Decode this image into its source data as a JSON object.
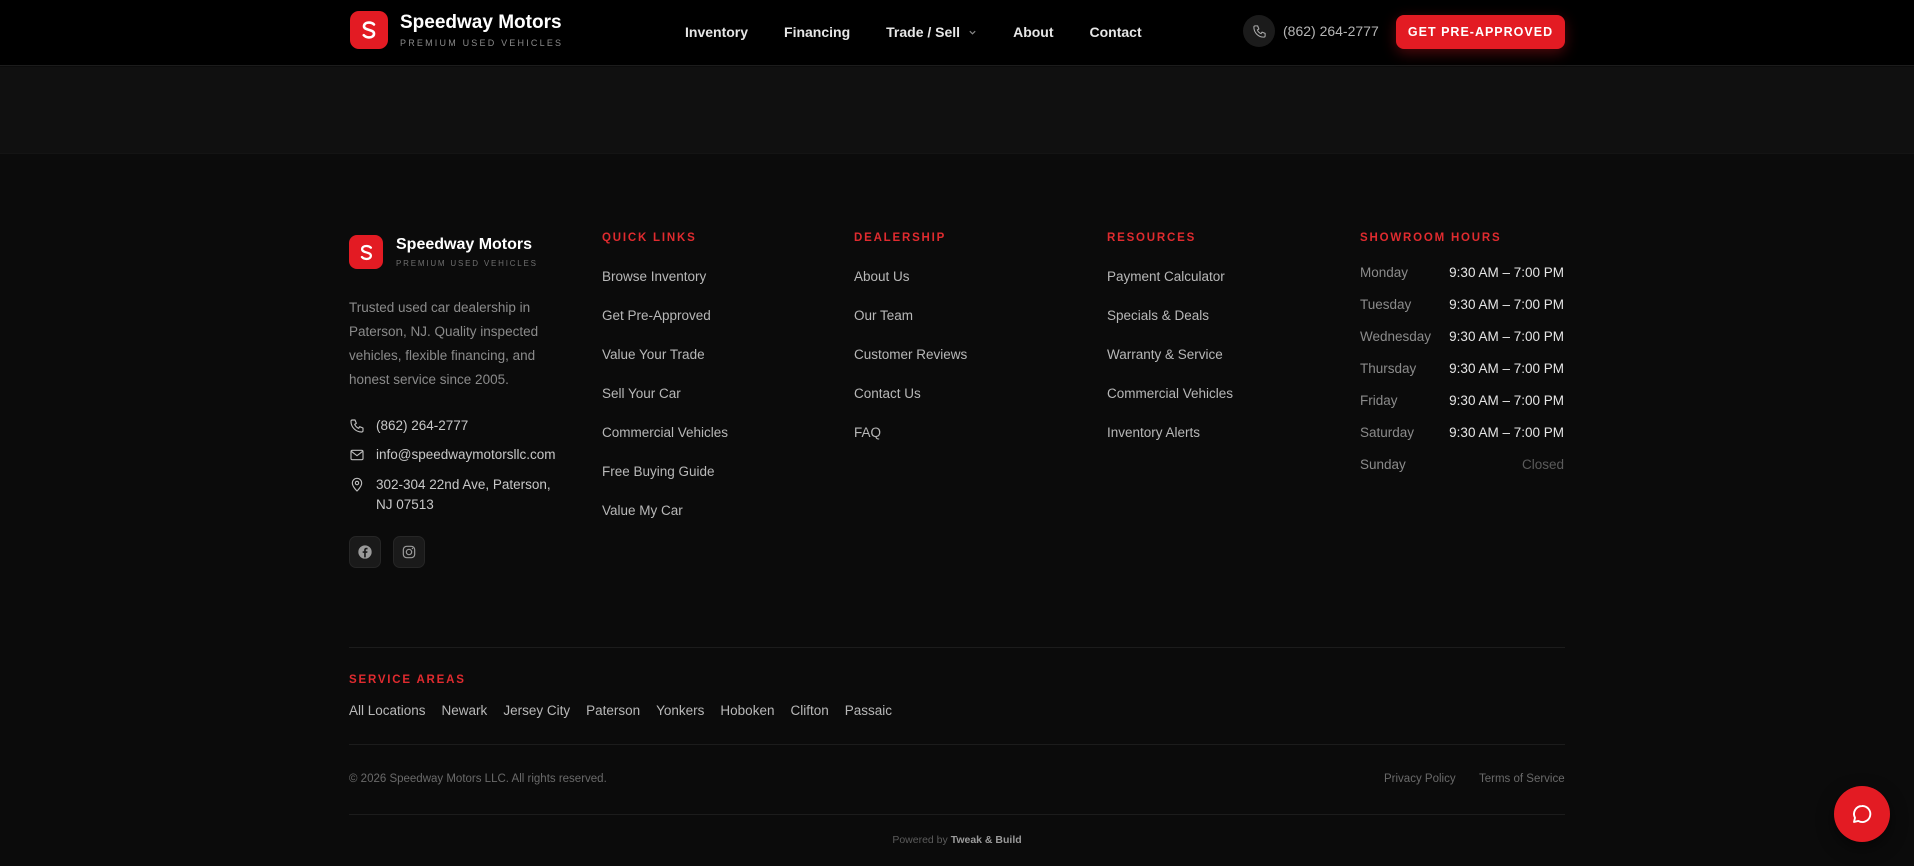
{
  "brand": {
    "name": "Speedway Motors",
    "tagline": "PREMIUM USED VEHICLES",
    "logo_icon": "s-logo-icon"
  },
  "nav": {
    "items": [
      "Inventory",
      "Financing",
      "Trade / Sell",
      "About",
      "Contact"
    ],
    "phone": "(862) 264-2777",
    "cta": "GET PRE-APPROVED"
  },
  "footer": {
    "description": "Trusted used car dealership in Paterson, NJ. Quality inspected vehicles, flexible financing, and honest service since 2005.",
    "phone": "(862) 264-2777",
    "email": "info@speedwaymotorsllc.com",
    "address": "302-304 22nd Ave, Paterson, NJ 07513",
    "quick_links": {
      "title": "QUICK LINKS",
      "items": [
        "Browse Inventory",
        "Get Pre-Approved",
        "Value Your Trade",
        "Sell Your Car",
        "Commercial Vehicles",
        "Free Buying Guide",
        "Value My Car"
      ]
    },
    "dealership": {
      "title": "DEALERSHIP",
      "items": [
        "About Us",
        "Our Team",
        "Customer Reviews",
        "Contact Us",
        "FAQ"
      ]
    },
    "resources": {
      "title": "RESOURCES",
      "items": [
        "Payment Calculator",
        "Specials & Deals",
        "Warranty & Service",
        "Commercial Vehicles",
        "Inventory Alerts"
      ]
    },
    "hours": {
      "title": "SHOWROOM HOURS",
      "rows": [
        {
          "day": "Monday",
          "time": "9:30 AM – 7:00 PM"
        },
        {
          "day": "Tuesday",
          "time": "9:30 AM – 7:00 PM"
        },
        {
          "day": "Wednesday",
          "time": "9:30 AM – 7:00 PM"
        },
        {
          "day": "Thursday",
          "time": "9:30 AM – 7:00 PM"
        },
        {
          "day": "Friday",
          "time": "9:30 AM – 7:00 PM"
        },
        {
          "day": "Saturday",
          "time": "9:30 AM – 7:00 PM"
        },
        {
          "day": "Sunday",
          "time": "Closed"
        }
      ]
    },
    "service_areas": {
      "title": "SERVICE AREAS",
      "items": [
        "All Locations",
        "Newark",
        "Jersey City",
        "Paterson",
        "Yonkers",
        "Hoboken",
        "Clifton",
        "Passaic"
      ]
    },
    "copyright": "© 2026 Speedway Motors LLC. All rights reserved.",
    "privacy": "Privacy Policy",
    "terms": "Terms of Service",
    "powered_prefix": "Powered by",
    "powered_name": "Tweak & Build"
  },
  "colors": {
    "accent": "#e31b23",
    "background": "#0b0b0b",
    "header": "#000000"
  }
}
